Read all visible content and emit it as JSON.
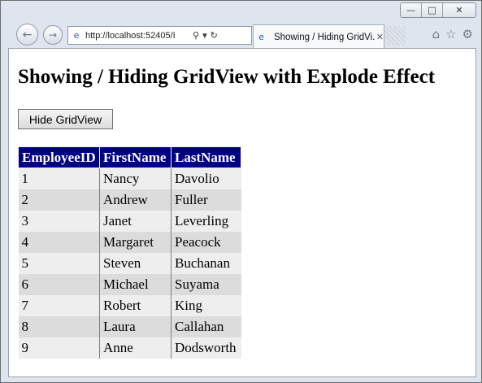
{
  "window": {
    "controls": {
      "minimize": "—",
      "maximize": "□",
      "close": "✕"
    }
  },
  "browser": {
    "back_icon": "←",
    "forward_icon": "→",
    "address": {
      "url": "http://localhost:52405/I",
      "search_icon": "⚲",
      "dropdown_icon": "▾",
      "refresh_icon": "↻"
    },
    "tab": {
      "title": "Showing / Hiding GridVi...",
      "close_icon": "✕"
    },
    "toolbar": {
      "home_icon": "⌂",
      "favorites_icon": "☆",
      "settings_icon": "⚙"
    }
  },
  "page": {
    "title": "Showing / Hiding GridView with Explode Effect",
    "hide_button_label": "Hide GridView",
    "grid": {
      "header_color": "#000084",
      "columns": [
        "EmployeeID",
        "FirstName",
        "LastName"
      ],
      "rows": [
        [
          "1",
          "Nancy",
          "Davolio"
        ],
        [
          "2",
          "Andrew",
          "Fuller"
        ],
        [
          "3",
          "Janet",
          "Leverling"
        ],
        [
          "4",
          "Margaret",
          "Peacock"
        ],
        [
          "5",
          "Steven",
          "Buchanan"
        ],
        [
          "6",
          "Michael",
          "Suyama"
        ],
        [
          "7",
          "Robert",
          "King"
        ],
        [
          "8",
          "Laura",
          "Callahan"
        ],
        [
          "9",
          "Anne",
          "Dodsworth"
        ]
      ]
    }
  }
}
